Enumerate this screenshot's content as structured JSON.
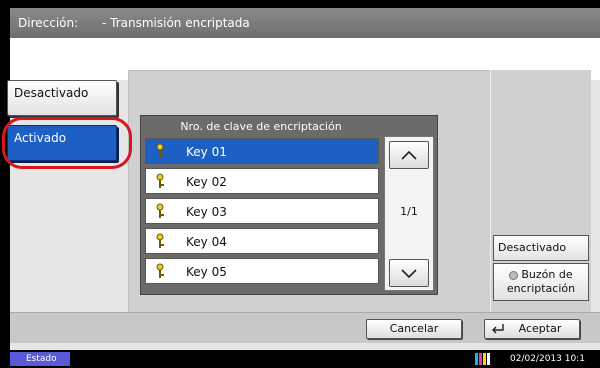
{
  "titlebar": {
    "label": "Dirección:",
    "value": "- Transmisión encriptada"
  },
  "mode_buttons": {
    "off": "Desactivado",
    "on": "Activado"
  },
  "key_list": {
    "header": "Nro. de clave de encriptación",
    "items": [
      {
        "label": "Key 01",
        "selected": true
      },
      {
        "label": "Key 02",
        "selected": false
      },
      {
        "label": "Key 03",
        "selected": false
      },
      {
        "label": "Key 04",
        "selected": false
      },
      {
        "label": "Key 05",
        "selected": false
      }
    ],
    "page": "1/1"
  },
  "right_options": {
    "off": "Desactivado",
    "box_line1": "Buzón de",
    "box_line2": "encriptación"
  },
  "footer": {
    "cancel": "Cancelar",
    "accept": "Aceptar"
  },
  "status": {
    "label": "Estado",
    "datetime": "02/02/2013 10:1"
  },
  "colors": {
    "selected": "#1e5fc4",
    "highlight": "#d8161d",
    "status": "#5a5ad8"
  }
}
